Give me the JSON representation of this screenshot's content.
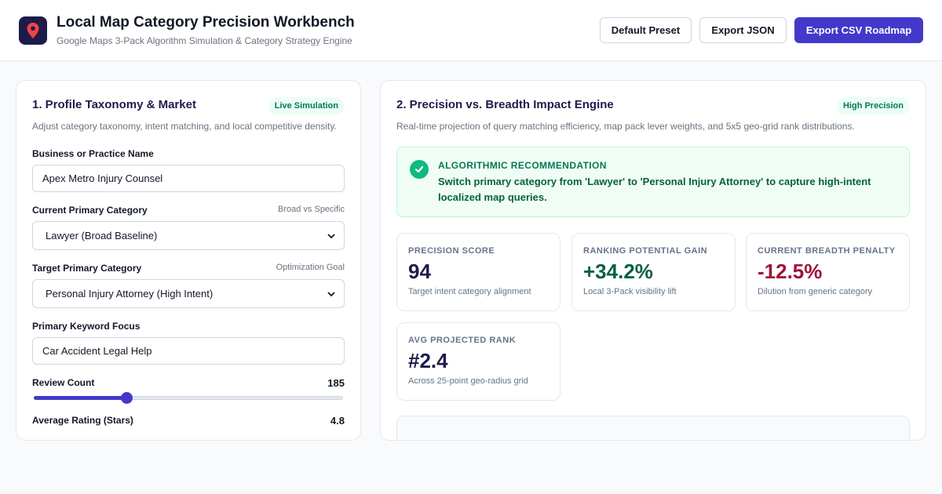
{
  "app": {
    "title": "Local Map Category Precision Workbench",
    "subtitle": "Google Maps 3-Pack Algorithm Simulation & Category Strategy Engine",
    "logo_icon": "map-pin-icon",
    "logo_color": "#1e1b4b"
  },
  "toolbar": {
    "preset_label": "Default Preset",
    "json_label": "Export JSON",
    "csv_label": "Export CSV Roadmap",
    "accent_color": "#4338ca"
  },
  "left_panel": {
    "title": "1. Profile Taxonomy & Market",
    "badge": "Live Simulation",
    "description": "Adjust category taxonomy, intent matching, and local competitive density.",
    "business_name": {
      "label": "Business or Practice Name",
      "value": "Apex Metro Injury Counsel"
    },
    "current_category": {
      "label": "Current Primary Category",
      "hint": "Broad vs Specific",
      "selected": "Lawyer (Broad Baseline)"
    },
    "target_category": {
      "label": "Target Primary Category",
      "hint": "Optimization Goal",
      "selected": "Personal Injury Attorney (High Intent)"
    },
    "keyword": {
      "label": "Primary Keyword Focus",
      "value": "Car Accident Legal Help"
    },
    "review_count": {
      "label": "Review Count",
      "value": "185",
      "fraction": 0.3
    },
    "average_rating": {
      "label": "Average Rating (Stars)",
      "value": "4.8"
    }
  },
  "right_panel": {
    "title": "2. Precision vs. Breadth Impact Engine",
    "badge": "High Precision",
    "description": "Real-time projection of query matching efficiency, map pack lever weights, and 5x5 geo-grid rank distributions.",
    "recommendation": {
      "title": "ALGORITHMIC RECOMMENDATION",
      "text": "Switch primary category from 'Lawyer' to 'Personal Injury Attorney' to capture high-intent localized map queries."
    },
    "metrics": [
      {
        "label": "PRECISION SCORE",
        "value": "94",
        "note": "Target intent category alignment",
        "color": "#1e1b4b"
      },
      {
        "label": "RANKING POTENTIAL GAIN",
        "value": "+34.2%",
        "note": "Local 3-Pack visibility lift",
        "color": "#065f46"
      },
      {
        "label": "CURRENT BREADTH PENALTY",
        "value": "-12.5%",
        "note": "Dilution from generic category",
        "color": "#9f1239"
      },
      {
        "label": "AVG PROJECTED RANK",
        "value": "#2.4",
        "note": "Across 25-point geo-radius grid",
        "color": "#1e1b4b"
      }
    ]
  }
}
